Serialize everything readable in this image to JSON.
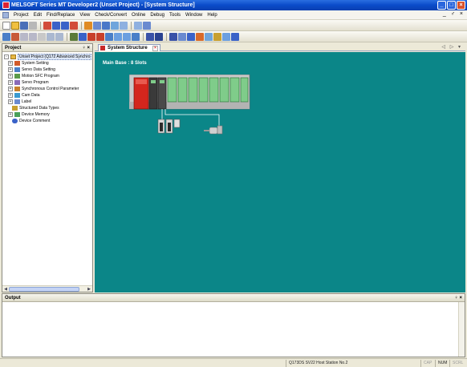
{
  "window": {
    "title": "MELSOFT Series MT Developer2 (Unset Project) - [System Structure]",
    "controls": [
      "_",
      "□",
      "×"
    ]
  },
  "menubar": {
    "items": [
      "Project",
      "Edit",
      "Find/Replace",
      "View",
      "Check/Convert",
      "Online",
      "Debug",
      "Tools",
      "Window",
      "Help"
    ],
    "mdi_controls": "_ ♂ ×"
  },
  "project_panel": {
    "title": "Project",
    "controls": "♀ ×",
    "tree": [
      {
        "label": "Unset Project (Q172 Advanced Synchro",
        "level": 0,
        "expander": "-",
        "icon": "project-icon"
      },
      {
        "label": "System Setting",
        "level": 1,
        "expander": "+",
        "icon": "system-setting-icon"
      },
      {
        "label": "Servo Data Setting",
        "level": 1,
        "expander": "+",
        "icon": "servo-data-icon"
      },
      {
        "label": "Motion SFC Program",
        "level": 1,
        "expander": "+",
        "icon": "sfc-program-icon"
      },
      {
        "label": "Servo Program",
        "level": 1,
        "expander": "+",
        "icon": "servo-program-icon"
      },
      {
        "label": "Synchronous Control Parameter",
        "level": 1,
        "expander": "+",
        "icon": "sync-control-icon"
      },
      {
        "label": "Cam Data",
        "level": 1,
        "expander": "+",
        "icon": "cam-data-icon"
      },
      {
        "label": "Label",
        "level": 1,
        "expander": "+",
        "icon": "label-icon"
      },
      {
        "label": "Structured Data Types",
        "level": 2,
        "expander": "",
        "icon": "struct-types-icon"
      },
      {
        "label": "Device Memory",
        "level": 1,
        "expander": "+",
        "icon": "device-memory-icon"
      },
      {
        "label": "Device Comment",
        "level": 2,
        "expander": "",
        "icon": "device-comment-icon"
      }
    ]
  },
  "document": {
    "tab_label": "System Structure",
    "nav": "◁ ▷ ▾",
    "main_base_label": "Main Base : 8 Slots"
  },
  "output_panel": {
    "title": "Output",
    "controls": "♀ ×"
  },
  "statusbar": {
    "cells": [
      {
        "text": "Q173DS  SV22   Host Station No.2",
        "dim": false
      },
      {
        "text": "CAP",
        "dim": true
      },
      {
        "text": "NUM",
        "dim": false
      },
      {
        "text": "SCRL",
        "dim": true
      }
    ]
  },
  "colors": {
    "canvas": "#0b8688",
    "title_bar": "#0a4bc9",
    "power_module": "#d4261d",
    "io_module": "#7fcc8a"
  }
}
